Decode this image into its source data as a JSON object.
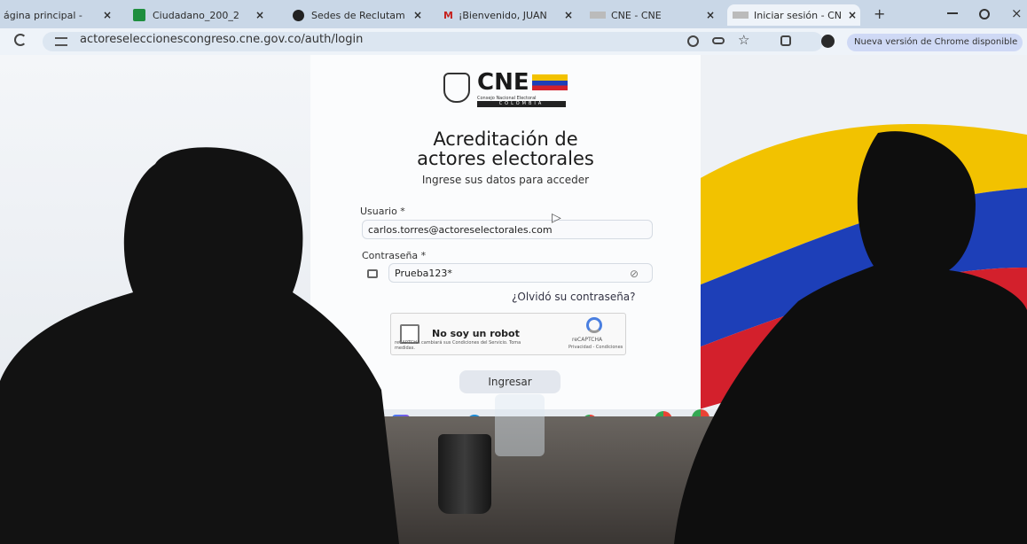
{
  "browser": {
    "tabs": [
      {
        "label": "ágina principal -",
        "close": "×"
      },
      {
        "label": "Ciudadano_200_2",
        "close": "×"
      },
      {
        "label": "Sedes de Reclutam",
        "close": "×"
      },
      {
        "label": "¡Bienvenido, JUAN",
        "close": "×"
      },
      {
        "label": "CNE - CNE",
        "close": "×"
      },
      {
        "label": "Iniciar sesión - CN",
        "close": "×"
      }
    ],
    "url": "actoreseleccionescongreso.cne.gov.co/auth/login",
    "update_label": "Nueva versión de Chrome disponible"
  },
  "login": {
    "logo_text": "CNE",
    "logo_sub": "Consejo Nacional Electoral",
    "logo_country": "COLOMBIA",
    "title_line1": "Acreditación de",
    "title_line2": "actores electorales",
    "subtitle": "Ingrese sus datos para acceder",
    "user_label": "Usuario *",
    "user_value": "carlos.torres@actoreselectorales.com",
    "password_label": "Contraseña *",
    "password_value": "Prueba123*",
    "forgot_link": "¿Olvidó su contraseña?",
    "captcha_label": "No soy un robot",
    "captcha_brand": "reCAPTCHA",
    "captcha_terms": "Privacidad - Condiciones",
    "captcha_notice": "reCAPTCHA cambiará sus Condiciones del Servicio. Toma medidas.",
    "submit_label": "Ingresar"
  },
  "colors": {
    "flag_yellow": "#f2c200",
    "flag_blue": "#1d3fb8",
    "flag_red": "#d3202c"
  }
}
